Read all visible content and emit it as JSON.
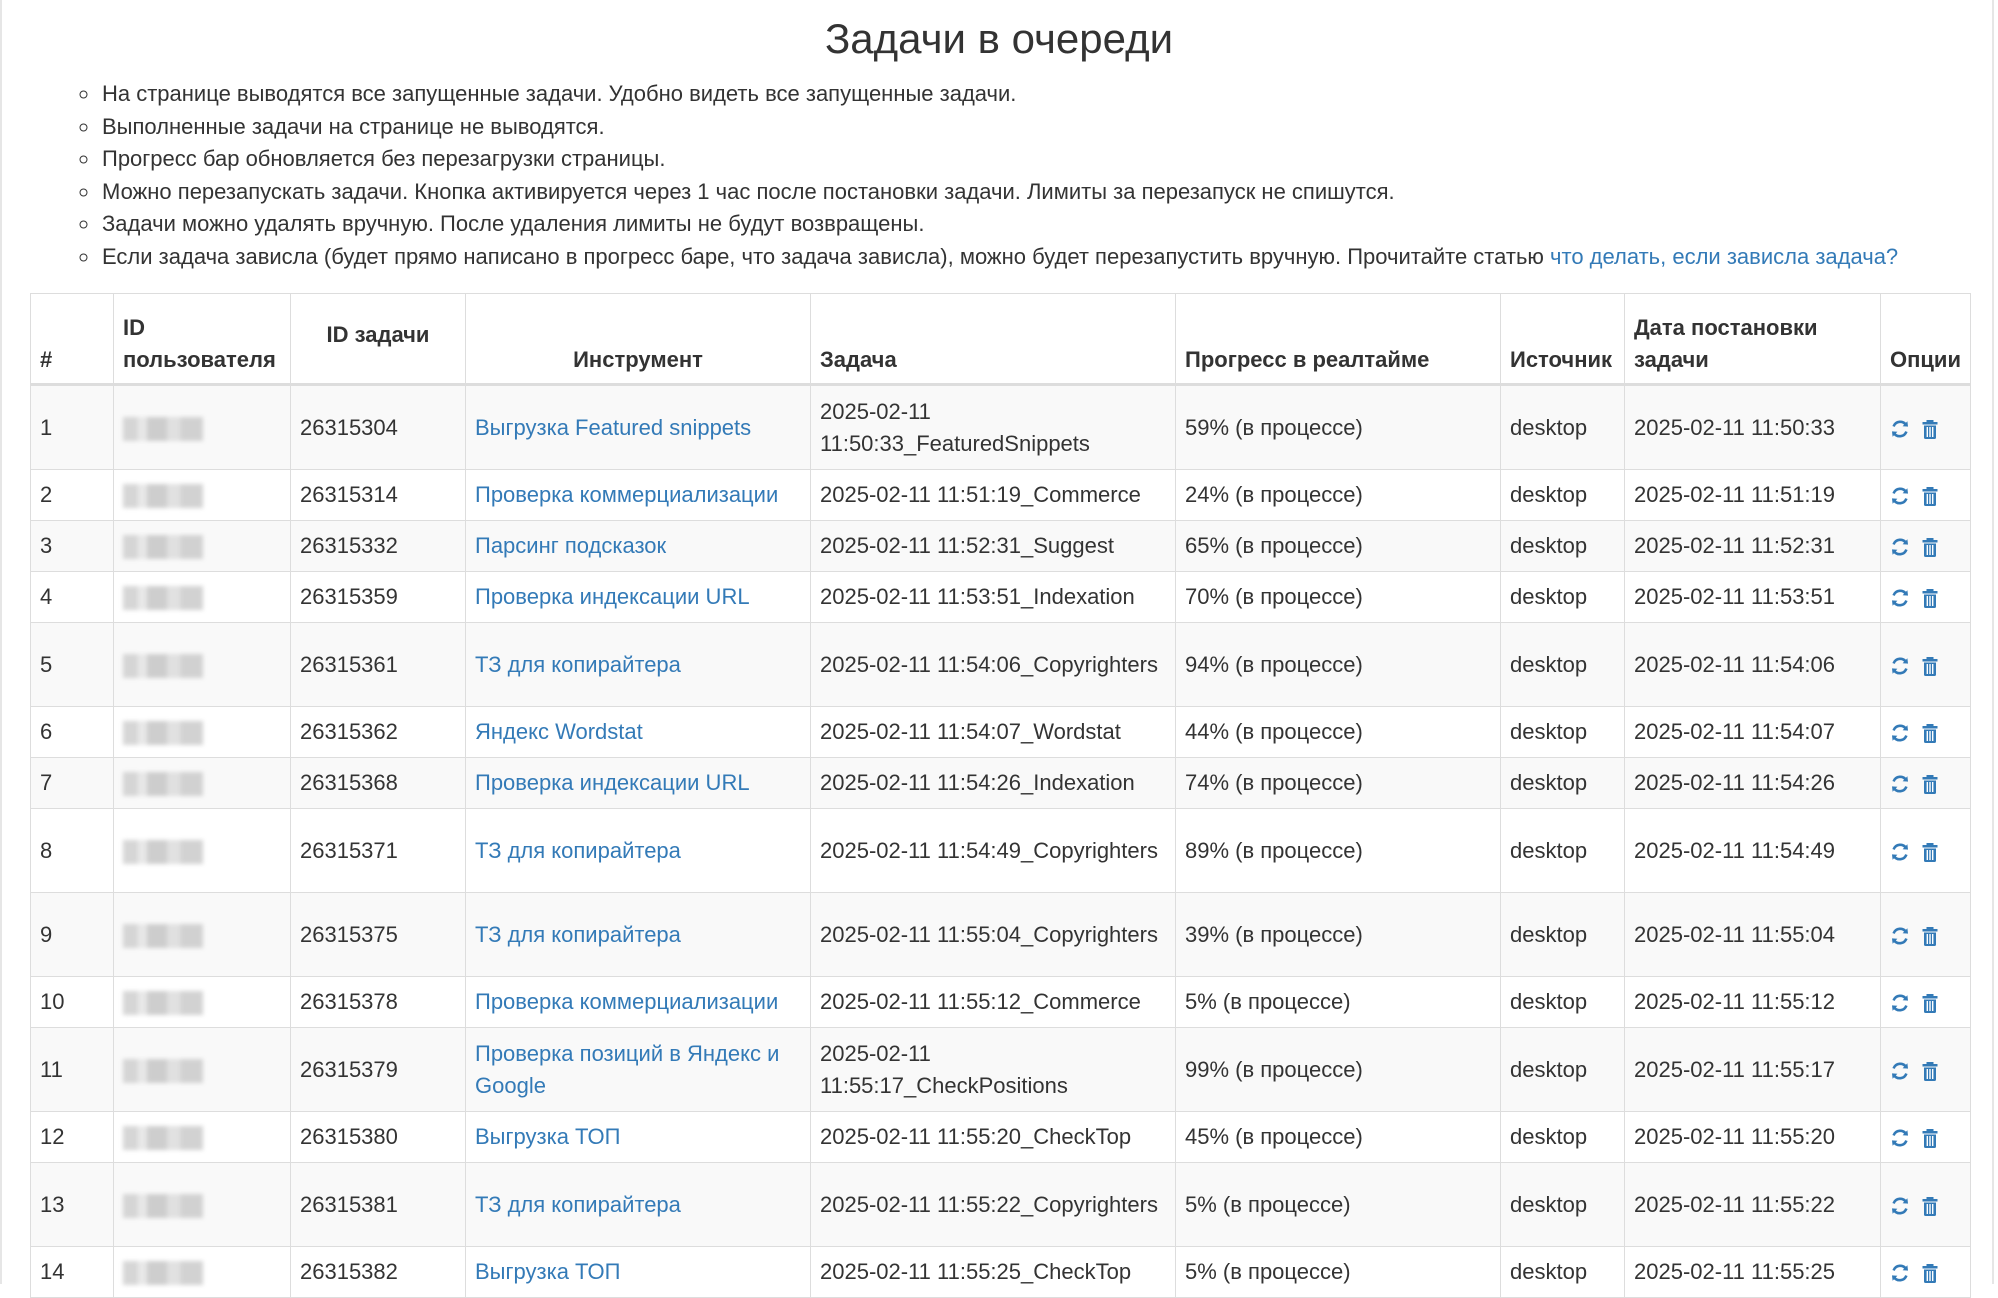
{
  "title": "Задачи в очереди",
  "notes": [
    {
      "text": "На странице выводятся все запущенные задачи. Удобно видеть все запущенные задачи."
    },
    {
      "text": "Выполненные задачи на странице не выводятся."
    },
    {
      "text": "Прогресс бар обновляется без перезагрузки страницы."
    },
    {
      "text": "Можно перезапускать задачи. Кнопка активируется через 1 час после постановки задачи. Лимиты за перезапуск не спишутся."
    },
    {
      "text": "Задачи можно удалять вручную. После удаления лимиты не будут возвращены."
    },
    {
      "text": "Если задача зависла (будет прямо написано в прогресс баре, что задача зависла), можно будет перезапустить вручную. Прочитайте статью ",
      "link": "что делать, если зависла задача?"
    }
  ],
  "table": {
    "headers": {
      "num": "#",
      "user_id": "ID пользователя",
      "task_id": "ID задачи",
      "tool": "Инструмент",
      "task": "Задача",
      "progress": "Прогресс в реалтайме",
      "source": "Источник",
      "date": "Дата постановки задачи",
      "options": "Опции"
    },
    "icons": {
      "restart": "refresh-icon",
      "delete": "trash-icon",
      "color": "#337ab7"
    },
    "rows": [
      {
        "num": "1",
        "task_id": "26315304",
        "tool": "Выгрузка Featured snippets",
        "task": "2025-02-11 11:50:33_FeaturedSnippets",
        "progress": "59% (в процессе)",
        "source": "desktop",
        "date": "2025-02-11 11:50:33"
      },
      {
        "num": "2",
        "task_id": "26315314",
        "tool": "Проверка коммерциализации",
        "task": "2025-02-11 11:51:19_Commerce",
        "progress": "24% (в процессе)",
        "source": "desktop",
        "date": "2025-02-11 11:51:19"
      },
      {
        "num": "3",
        "task_id": "26315332",
        "tool": "Парсинг подсказок",
        "task": "2025-02-11 11:52:31_Suggest",
        "progress": "65% (в процессе)",
        "source": "desktop",
        "date": "2025-02-11 11:52:31"
      },
      {
        "num": "4",
        "task_id": "26315359",
        "tool": "Проверка индексации URL",
        "task": "2025-02-11 11:53:51_Indexation",
        "progress": "70% (в процессе)",
        "source": "desktop",
        "date": "2025-02-11 11:53:51"
      },
      {
        "num": "5",
        "task_id": "26315361",
        "tool": "ТЗ для копирайтера",
        "task": "2025-02-11 11:54:06_Copyrighters",
        "progress": "94% (в процессе)",
        "source": "desktop",
        "date": "2025-02-11 11:54:06"
      },
      {
        "num": "6",
        "task_id": "26315362",
        "tool": "Яндекс Wordstat",
        "task": "2025-02-11 11:54:07_Wordstat",
        "progress": "44% (в процессе)",
        "source": "desktop",
        "date": "2025-02-11 11:54:07"
      },
      {
        "num": "7",
        "task_id": "26315368",
        "tool": "Проверка индексации URL",
        "task": "2025-02-11 11:54:26_Indexation",
        "progress": "74% (в процессе)",
        "source": "desktop",
        "date": "2025-02-11 11:54:26"
      },
      {
        "num": "8",
        "task_id": "26315371",
        "tool": "ТЗ для копирайтера",
        "task": "2025-02-11 11:54:49_Copyrighters",
        "progress": "89% (в процессе)",
        "source": "desktop",
        "date": "2025-02-11 11:54:49"
      },
      {
        "num": "9",
        "task_id": "26315375",
        "tool": "ТЗ для копирайтера",
        "task": "2025-02-11 11:55:04_Copyrighters",
        "progress": "39% (в процессе)",
        "source": "desktop",
        "date": "2025-02-11 11:55:04"
      },
      {
        "num": "10",
        "task_id": "26315378",
        "tool": "Проверка коммерциализации",
        "task": "2025-02-11 11:55:12_Commerce",
        "progress": "5% (в процессе)",
        "source": "desktop",
        "date": "2025-02-11 11:55:12"
      },
      {
        "num": "11",
        "task_id": "26315379",
        "tool": "Проверка позиций в Яндекс и Google",
        "task": "2025-02-11 11:55:17_CheckPositions",
        "progress": "99% (в процессе)",
        "source": "desktop",
        "date": "2025-02-11 11:55:17"
      },
      {
        "num": "12",
        "task_id": "26315380",
        "tool": "Выгрузка ТОП",
        "task": "2025-02-11 11:55:20_CheckTop",
        "progress": "45% (в процессе)",
        "source": "desktop",
        "date": "2025-02-11 11:55:20"
      },
      {
        "num": "13",
        "task_id": "26315381",
        "tool": "ТЗ для копирайтера",
        "task": "2025-02-11 11:55:22_Copyrighters",
        "progress": "5% (в процессе)",
        "source": "desktop",
        "date": "2025-02-11 11:55:22"
      },
      {
        "num": "14",
        "task_id": "26315382",
        "tool": "Выгрузка ТОП",
        "task": "2025-02-11 11:55:25_CheckTop",
        "progress": "5% (в процессе)",
        "source": "desktop",
        "date": "2025-02-11 11:55:25"
      }
    ]
  }
}
